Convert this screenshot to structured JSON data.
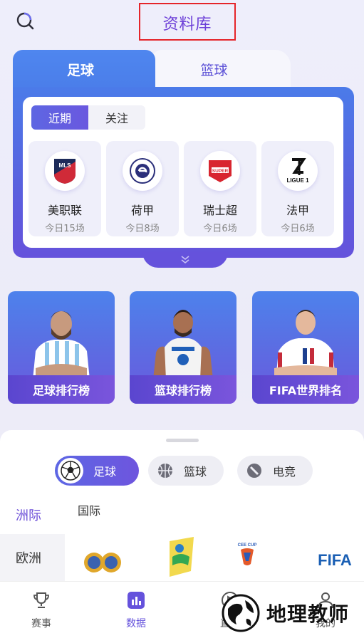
{
  "header": {
    "title": "资料库"
  },
  "sport_tabs": {
    "football": "足球",
    "basketball": "篮球"
  },
  "league_panel": {
    "subtabs": {
      "recent": "近期",
      "follow": "关注"
    },
    "leagues": [
      {
        "name": "美职联",
        "today": "今日15场",
        "logo": "MLS"
      },
      {
        "name": "荷甲",
        "today": "今日8场",
        "logo": "eredivisie-logo"
      },
      {
        "name": "瑞士超",
        "today": "今日6场",
        "logo": "SUPER"
      },
      {
        "name": "法甲",
        "today": "今日6场",
        "logo": "LIGUE 1"
      }
    ]
  },
  "rankings": [
    {
      "label": "足球排行榜"
    },
    {
      "label": "篮球排行榜"
    },
    {
      "label": "FIFA世界排名"
    }
  ],
  "bottom_sheet": {
    "sport_filters": [
      {
        "label": "足球",
        "icon": "soccer-ball-icon"
      },
      {
        "label": "篮球",
        "icon": "basketball-icon"
      },
      {
        "label": "电竞",
        "icon": "esports-icon"
      }
    ],
    "regions": [
      {
        "label": "洲际"
      },
      {
        "label": "欧洲"
      }
    ],
    "category": "国际",
    "competition_logos": {
      "cee": "CEE CUP",
      "fifa": "FIFA"
    }
  },
  "nav": [
    {
      "label": "赛事",
      "icon": "trophy-icon"
    },
    {
      "label": "数据",
      "icon": "chart-icon"
    },
    {
      "label": "直播",
      "icon": "play-icon"
    },
    {
      "label": "我的",
      "icon": "user-icon"
    }
  ],
  "watermark": {
    "text": "地理教师"
  },
  "colors": {
    "accent": "#6c4fd8",
    "blue": "#4f86ef",
    "highlight_border": "#e5252a"
  }
}
